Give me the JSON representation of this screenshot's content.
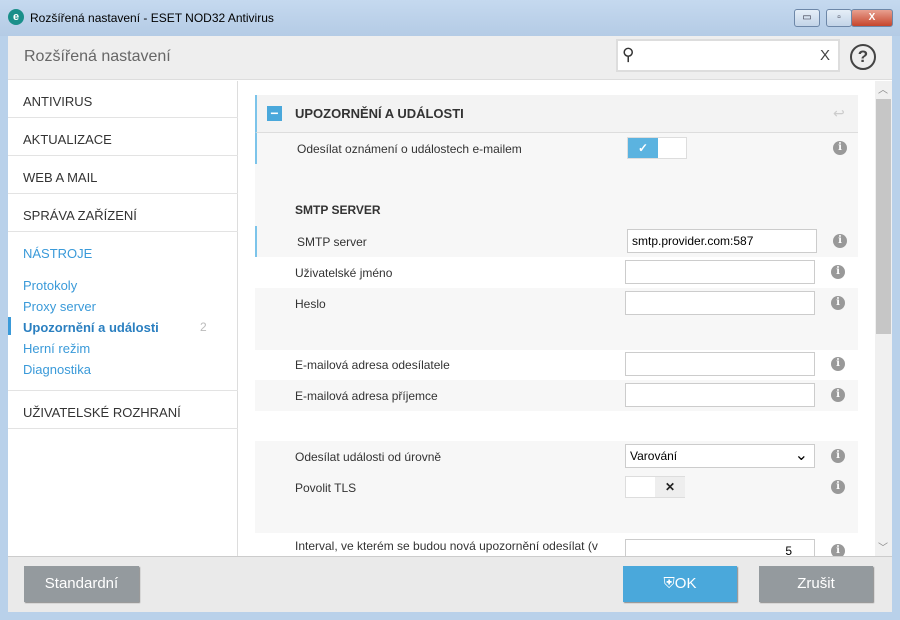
{
  "window": {
    "title": "Rozšířená nastavení - ESET NOD32 Antivirus",
    "icon": "e",
    "minimize": "▭",
    "maximize": "▫",
    "close": "X"
  },
  "header": {
    "title": "Rozšířená nastavení",
    "search_placeholder": "",
    "search_clear": "X",
    "help": "?"
  },
  "sidebar": {
    "items": [
      "ANTIVIRUS",
      "AKTUALIZACE",
      "WEB A MAIL",
      "SPRÁVA ZAŘÍZENÍ",
      "NÁSTROJE",
      "UŽIVATELSKÉ ROZHRANÍ"
    ],
    "subitems": [
      "Protokoly",
      "Proxy server",
      "Upozornění a události",
      "Herní režim",
      "Diagnostika"
    ],
    "selected_badge": "2"
  },
  "section": {
    "title": "UPOZORNĚNÍ A UDÁLOSTI",
    "collapse": "−",
    "revert": "↩"
  },
  "rows": {
    "send_email": {
      "label": "Odesílat oznámení o událostech e-mailem",
      "enabled": true
    },
    "smtp_heading": "SMTP SERVER",
    "smtp_server": {
      "label": "SMTP server",
      "value": "smtp.provider.com:587"
    },
    "username": {
      "label": "Uživatelské jméno",
      "value": ""
    },
    "password": {
      "label": "Heslo",
      "value": ""
    },
    "sender": {
      "label": "E-mailová adresa odesílatele",
      "value": ""
    },
    "recipient": {
      "label": "E-mailová adresa příjemce",
      "value": ""
    },
    "level": {
      "label": "Odesílat události od úrovně",
      "value": "Varování"
    },
    "tls": {
      "label": "Povolit TLS",
      "enabled": false
    },
    "interval": {
      "label": "Interval, ve kterém se budou nová upozornění odesílat (v",
      "value": "5"
    }
  },
  "icons": {
    "info": "i",
    "check": "✓",
    "cross": "✕",
    "chevron": "⌄"
  },
  "footer": {
    "default": "Standardní",
    "ok": "OK",
    "cancel": "Zrušit"
  },
  "colors": {
    "accent": "#4aa8db",
    "ok_button": "#4aa8db",
    "gray_button": "#949a9e"
  }
}
